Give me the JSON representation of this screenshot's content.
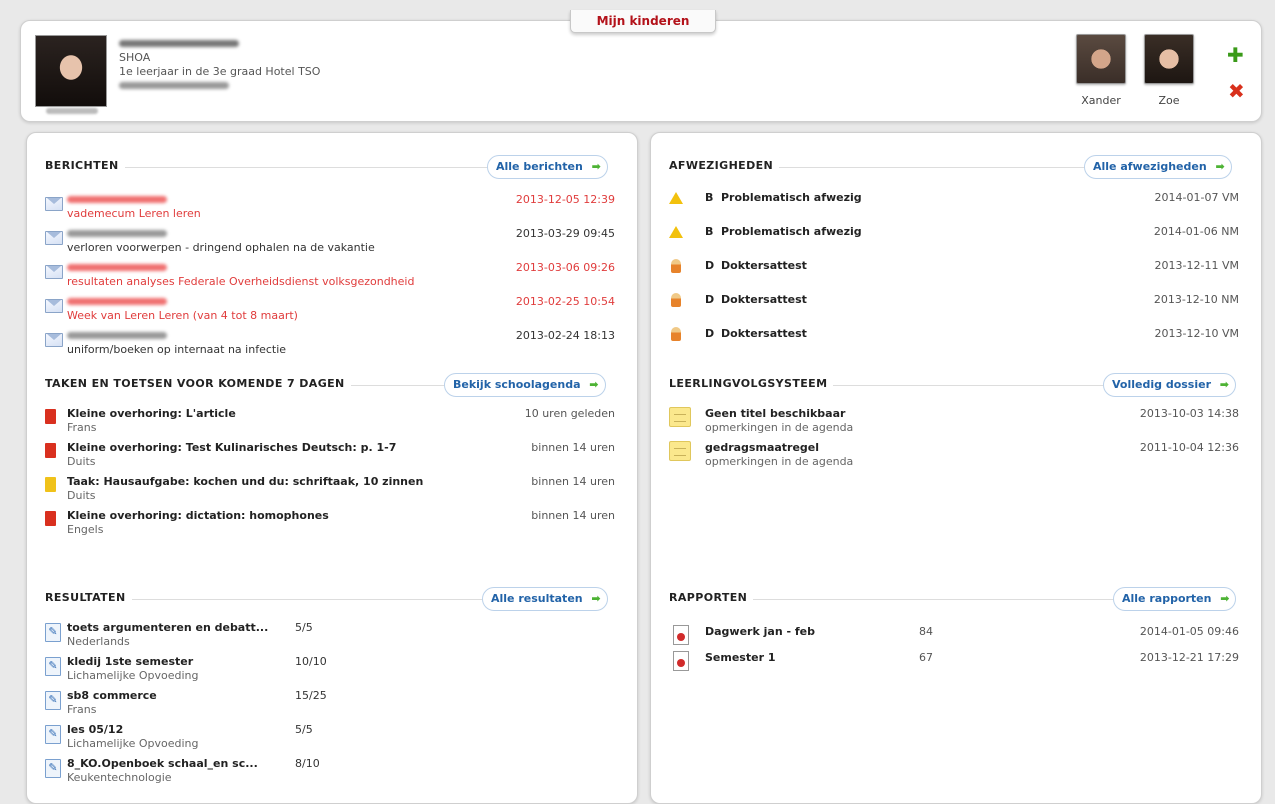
{
  "tab": {
    "label": "Mijn kinderen"
  },
  "student": {
    "school": "SHOA",
    "class": "1e leerjaar in de 3e graad Hotel TSO"
  },
  "children": [
    {
      "name": "Xander"
    },
    {
      "name": "Zoe"
    }
  ],
  "icons": {
    "add": "plus-icon",
    "remove": "x-icon",
    "arrow": "right-arrow-icon"
  },
  "colors": {
    "accent_red": "#b3121a",
    "unread": "#e03c3c",
    "link": "#2263a8",
    "arrow": "#4db334"
  },
  "berichten": {
    "title": "BERICHTEN",
    "link": "Alle berichten",
    "items": [
      {
        "subject": "vademecum Leren leren",
        "date": "2013-12-05 12:39",
        "unread": true
      },
      {
        "subject": "verloren voorwerpen - dringend ophalen na de vakantie",
        "date": "2013-03-29 09:45",
        "unread": false
      },
      {
        "subject": "resultaten analyses Federale Overheidsdienst volksgezondheid",
        "date": "2013-03-06 09:26",
        "unread": true
      },
      {
        "subject": "Week van Leren Leren (van 4 tot 8 maart)",
        "date": "2013-02-25 10:54",
        "unread": true
      },
      {
        "subject": "uniform/boeken op internaat na infectie",
        "date": "2013-02-24 18:13",
        "unread": false
      }
    ]
  },
  "taken": {
    "title": "TAKEN EN TOETSEN VOOR KOMENDE 7 DAGEN",
    "link": "Bekijk schoolagenda",
    "items": [
      {
        "title": "Kleine overhoring: L'article",
        "subject": "Frans",
        "when": "10 uren geleden",
        "color": "#d9301f"
      },
      {
        "title": "Kleine overhoring: Test Kulinarisches Deutsch: p. 1-7",
        "subject": "Duits",
        "when": "binnen 14 uren",
        "color": "#d9301f"
      },
      {
        "title": "Taak: Hausaufgabe: kochen und du: schriftaak, 10 zinnen",
        "subject": "Duits",
        "when": "binnen 14 uren",
        "color": "#f0c21a"
      },
      {
        "title": "Kleine overhoring: dictation: homophones",
        "subject": "Engels",
        "when": "binnen 14 uren",
        "color": "#d9301f"
      }
    ]
  },
  "resultaten": {
    "title": "RESULTATEN",
    "link": "Alle resultaten",
    "items": [
      {
        "title": "toets argumenteren en debatt...",
        "subject": "Nederlands",
        "score": "5/5"
      },
      {
        "title": "kledij 1ste semester",
        "subject": "Lichamelijke Opvoeding",
        "score": "10/10"
      },
      {
        "title": "sb8 commerce",
        "subject": "Frans",
        "score": "15/25"
      },
      {
        "title": "les 05/12",
        "subject": "Lichamelijke Opvoeding",
        "score": "5/5"
      },
      {
        "title": "8_KO.Openboek schaal_en sc...",
        "subject": "Keukentechnologie",
        "score": "8/10"
      }
    ]
  },
  "afwezigheden": {
    "title": "AFWEZIGHEDEN",
    "link": "Alle afwezigheden",
    "items": [
      {
        "code": "B",
        "label": "Problematisch afwezig",
        "date": "2014-01-07 VM",
        "type": "warning"
      },
      {
        "code": "B",
        "label": "Problematisch afwezig",
        "date": "2014-01-06 NM",
        "type": "warning"
      },
      {
        "code": "D",
        "label": "Doktersattest",
        "date": "2013-12-11 VM",
        "type": "doctor"
      },
      {
        "code": "D",
        "label": "Doktersattest",
        "date": "2013-12-10 NM",
        "type": "doctor"
      },
      {
        "code": "D",
        "label": "Doktersattest",
        "date": "2013-12-10 VM",
        "type": "doctor"
      }
    ]
  },
  "lvs": {
    "title": "LEERLINGVOLGSYSTEEM",
    "link": "Volledig dossier",
    "items": [
      {
        "title": "Geen titel beschikbaar",
        "sub": "opmerkingen in de agenda",
        "date": "2013-10-03 14:38"
      },
      {
        "title": "gedragsmaatregel",
        "sub": "opmerkingen in de agenda",
        "date": "2011-10-04 12:36"
      }
    ]
  },
  "rapporten": {
    "title": "RAPPORTEN",
    "link": "Alle rapporten",
    "items": [
      {
        "title": "Dagwerk jan - feb",
        "score": "84",
        "date": "2014-01-05 09:46"
      },
      {
        "title": "Semester 1",
        "score": "67",
        "date": "2013-12-21 17:29"
      }
    ]
  }
}
